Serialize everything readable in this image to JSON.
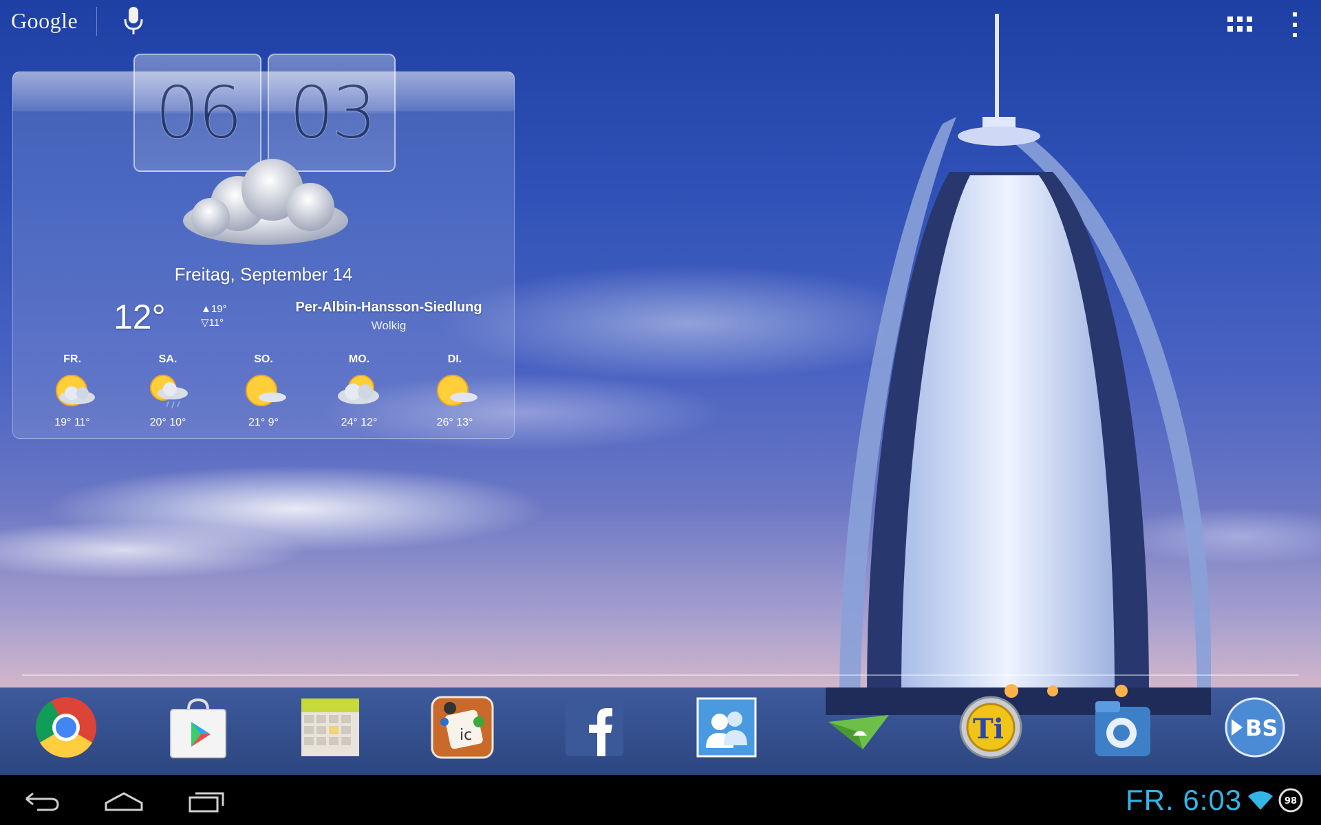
{
  "search": {
    "logo": "Google",
    "icon": "mic-icon"
  },
  "top_right": {
    "apps_icon": "apps-grid-icon",
    "menu_icon": "overflow-menu-icon"
  },
  "clock": {
    "hours": "06",
    "minutes": "03"
  },
  "weather": {
    "date": "Freitag, September 14",
    "current_temp": "12°",
    "high": "▲19°",
    "low": "▽11°",
    "location": "Per-Albin-Hansson-Siedlung",
    "condition": "Wolkig",
    "forecast": [
      {
        "day": "FR.",
        "temps": "19° 11°",
        "icon": "sun-cloud-icon"
      },
      {
        "day": "SA.",
        "temps": "20° 10°",
        "icon": "sun-cloud-rain-icon"
      },
      {
        "day": "SO.",
        "temps": "21° 9°",
        "icon": "sun-cloud-icon"
      },
      {
        "day": "MO.",
        "temps": "24° 12°",
        "icon": "cloud-sun-icon"
      },
      {
        "day": "DI.",
        "temps": "26° 13°",
        "icon": "sun-cloud-icon"
      }
    ]
  },
  "dock": [
    {
      "name": "chrome-icon"
    },
    {
      "name": "play-store-icon"
    },
    {
      "name": "calendar-app-icon"
    },
    {
      "name": "game-app-icon"
    },
    {
      "name": "facebook-icon"
    },
    {
      "name": "contacts-icon"
    },
    {
      "name": "airdroid-icon"
    },
    {
      "name": "titanium-backup-icon"
    },
    {
      "name": "file-manager-icon"
    },
    {
      "name": "bluestacks-icon"
    }
  ],
  "status": {
    "time": "FR. 6:03",
    "battery": "98"
  },
  "colors": {
    "accent": "#33b5e5"
  }
}
